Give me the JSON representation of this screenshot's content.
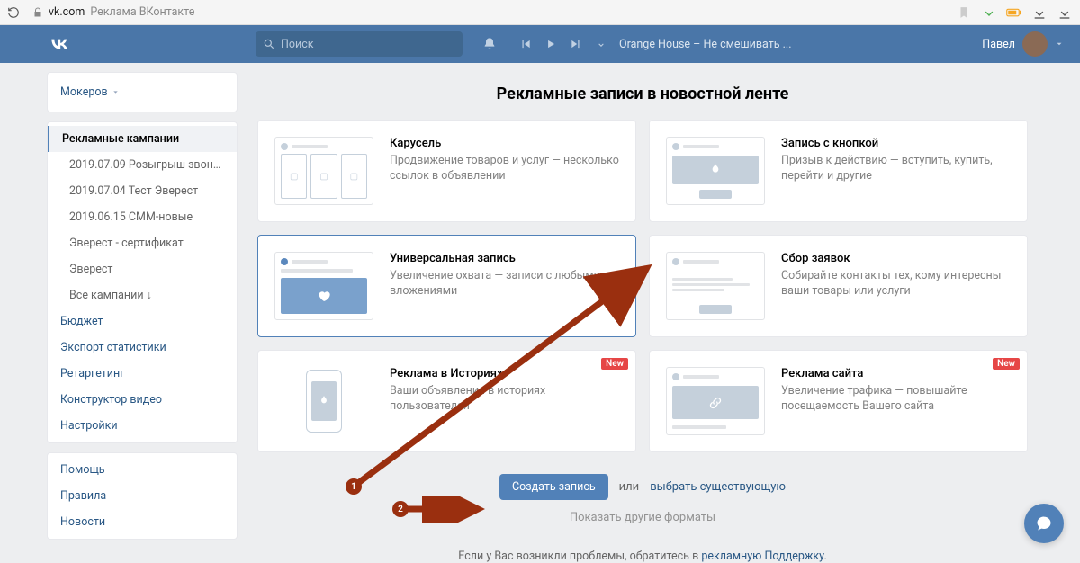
{
  "browser": {
    "domain": "vk.com",
    "title": "Реклама ВКонтакте"
  },
  "topbar": {
    "search_placeholder": "Поиск",
    "music_track": "Orange House – Не смешивать ...",
    "user_name": "Павел"
  },
  "sidebar": {
    "account": "Мокеров",
    "campaigns_label": "Рекламные кампании",
    "campaigns": [
      "2019.07.09 Розыгрыш звонка ...",
      "2019.07.04 Тест Эверест",
      "2019.06.15 СММ-новые",
      "Эверест - сертификат",
      "Эверест",
      "Все кампании ↓"
    ],
    "links": [
      "Бюджет",
      "Экспорт статистики",
      "Ретаргетинг",
      "Конструктор видео",
      "Настройки"
    ],
    "help": [
      "Помощь",
      "Правила",
      "Новости"
    ]
  },
  "main": {
    "title": "Рекламные записи в новостной ленте",
    "formats": [
      {
        "title": "Карусель",
        "desc": "Продвижение товаров и услуг — несколько ссылок в объявлении",
        "thumb": "carousel",
        "new": false,
        "selected": false
      },
      {
        "title": "Запись с кнопкой",
        "desc": "Призыв к действию — вступить, купить, перейти и другие",
        "thumb": "button",
        "new": false,
        "selected": false
      },
      {
        "title": "Универсальная запись",
        "desc": "Увеличение охвата — записи с любыми вложениями",
        "thumb": "universal",
        "new": false,
        "selected": true
      },
      {
        "title": "Сбор заявок",
        "desc": "Собирайте контакты тех, кому интересны ваши товары или услуги",
        "thumb": "leads",
        "new": false,
        "selected": false
      },
      {
        "title": "Реклама в Историях",
        "desc": "Ваши объявления в историях пользователей",
        "thumb": "stories",
        "new": true,
        "selected": false
      },
      {
        "title": "Реклама сайта",
        "desc": "Увеличение трафика — повышайте посещаемость Вашего сайта",
        "thumb": "site",
        "new": true,
        "selected": false
      }
    ],
    "new_badge": "New",
    "create_btn": "Создать запись",
    "or_label": "или",
    "choose_existing": "выбрать существующую",
    "more_formats": "Показать другие форматы",
    "footer_prefix": "Если у Вас возникли проблемы, обратитесь в ",
    "footer_link": "рекламную Поддержку",
    "footer_suffix": "."
  },
  "annotations": {
    "badge1": "1",
    "badge2": "2"
  }
}
